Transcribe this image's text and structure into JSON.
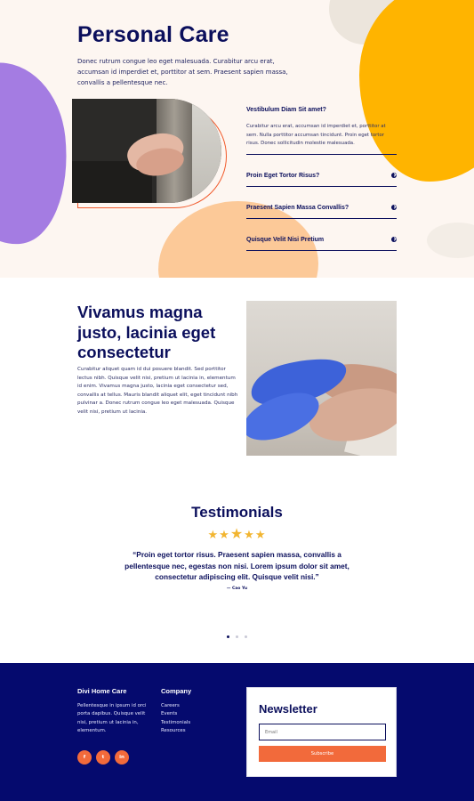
{
  "hero": {
    "title": "Personal Care",
    "text": "Donec rutrum congue leo eget malesuada. Curabitur arcu erat, accumsan id imperdiet et, porttitor at sem. Praesent sapien massa, convallis a pellentesque nec."
  },
  "faq": {
    "open_item": {
      "title": "Vestibulum Diam Sit amet?",
      "text": "Curabitur arcu erat, accumsan id imperdiet et, porttitor at sem. Nulla porttitor accumsan tincidunt. Proin eget tortor risus. Donec sollicitudin molestie malesuada."
    },
    "items": [
      {
        "label": "Proin Eget Tortor Risus?"
      },
      {
        "label": "Praesent Sapien Massa Convallis?"
      },
      {
        "label": "Quisque Velit Nisi Pretium"
      }
    ]
  },
  "section2": {
    "title": "Vivamus magna justo, lacinia eget consectetur",
    "text": "Curabitur aliquet quam id dui posuere blandit. Sed porttitor lectus nibh. Quisque velit nisi, pretium ut lacinia in, elementum id enim. Vivamus magna justo, lacinia eget consectetur sed, convallis at tellus. Mauris blandit aliquet elit, eget tincidunt nibh pulvinar a. Donec rutrum congue leo eget malesuada. Quisque velit nisi, pretium ut lacinia."
  },
  "testimonials": {
    "title": "Testimonials",
    "rating": 5,
    "quote": "“Proin eget tortor risus. Praesent sapien massa, convallis a pellentesque nec, egestas non nisi. Lorem ipsum dolor sit amet, consectetur adipiscing elit. Quisque velit nisi.”",
    "author": "— Cao Yu",
    "slides": 3,
    "active_slide": 1
  },
  "footer": {
    "brand_title": "Divi Home Care",
    "brand_text": "Pellentesque in ipsum id orci porta dapibus. Quisque velit nisi, pretium ut lacinia in, elementum.",
    "socials": [
      {
        "icon": "facebook-icon",
        "glyph": "f"
      },
      {
        "icon": "twitter-icon",
        "glyph": "t"
      },
      {
        "icon": "linkedin-icon",
        "glyph": "in"
      }
    ],
    "company_title": "Company",
    "links": [
      "Careers",
      "Events",
      "Testimonials",
      "Resources"
    ],
    "newsletter": {
      "title": "Newsletter",
      "email_placeholder": "Email",
      "button_label": "Subscribe"
    }
  },
  "colors": {
    "navy": "#0b0f5c",
    "footer_bg": "#050a6e",
    "accent_orange": "#f26a3b",
    "hero_bg": "#fdf6f1",
    "blob_purple": "#a47ce2",
    "blob_yellow": "#ffb400",
    "blob_peach": "#fcc998",
    "star": "#f2b530"
  }
}
